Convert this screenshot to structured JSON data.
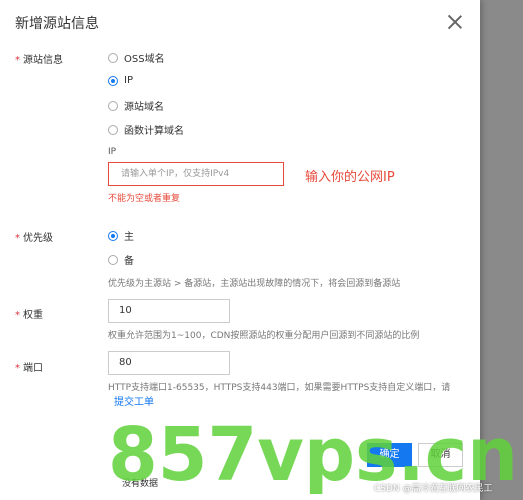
{
  "dialog": {
    "title": "新增源站信息"
  },
  "origin": {
    "label": "源站信息",
    "options": [
      {
        "label": "OSS域名",
        "checked": false
      },
      {
        "label": "IP",
        "checked": true
      },
      {
        "label": "源站域名",
        "checked": false
      },
      {
        "label": "函数计算域名",
        "checked": false
      }
    ],
    "ip_label": "IP",
    "ip_placeholder": "请输入单个IP，仅支持IPv4",
    "error": "不能为空或者重复",
    "annotation": "输入你的公网IP"
  },
  "priority": {
    "label": "优先级",
    "options": [
      {
        "label": "主",
        "checked": true
      },
      {
        "label": "备",
        "checked": false
      }
    ],
    "hint": "优先级为主源站 > 备源站，主源站出现故障的情况下，将会回源到备源站"
  },
  "weight": {
    "label": "权重",
    "value": "10",
    "hint": "权重允许范围为1~100，CDN按照源站的权重分配用户回源到不同源站的比例"
  },
  "port": {
    "label": "端口",
    "value": "80",
    "hint": "HTTP支持端口1-65535，HTTPS支持443端口，如果需要HTTPS支持自定义端口，请",
    "link": "提交工单"
  },
  "buttons": {
    "ok": "确定",
    "cancel": "取消"
  },
  "footer_partial": "没有数据",
  "watermark": {
    "text": "857vps.cn",
    "color": "#5fd13a"
  },
  "csdn": "CSDN @高冷滴互联网农民工",
  "colors": {
    "accent": "#1478f0",
    "error": "#e64a3b",
    "required": "#d9363e"
  }
}
